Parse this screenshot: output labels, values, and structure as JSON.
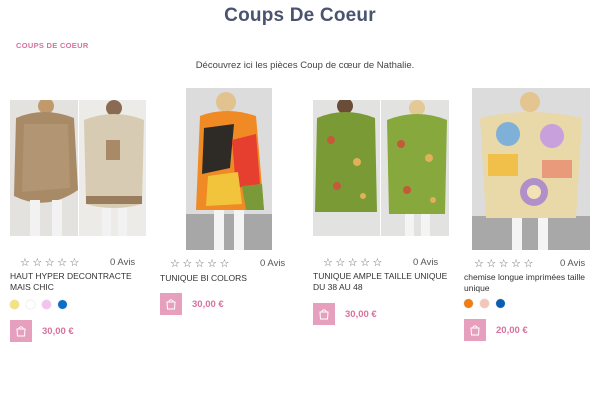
{
  "header": {
    "title": "Coups De Coeur"
  },
  "breadcrumb": {
    "label": "COUPS DE COEUR"
  },
  "intro": {
    "text": "Découvrez ici les pièces Coup de cœur de Nathalie."
  },
  "products": [
    {
      "name": "HAUT HYPER DECONTRACTE MAIS CHIC",
      "rating_stars": 0,
      "avis": "0 Avis",
      "price": "30,00 €",
      "swatches": [
        "#f7e27a",
        "#ffffff",
        "#f4c2f0",
        "#0b6fc9"
      ]
    },
    {
      "name": "TUNIQUE BI COLORS",
      "rating_stars": 0,
      "avis": "0 Avis",
      "price": "30,00 €",
      "swatches": []
    },
    {
      "name": "TUNIQUE AMPLE TAILLE UNIQUE DU 38 AU 48",
      "rating_stars": 0,
      "avis": "0 Avis",
      "price": "30,00 €",
      "swatches": []
    },
    {
      "name": "chemise longue imprimées taille unique",
      "rating_stars": 0,
      "avis": "0 Avis",
      "price": "20,00 €",
      "swatches": [
        "#f07d10",
        "#f4c6b6",
        "#0b5fb3"
      ]
    }
  ],
  "colors": {
    "title": "#4a5470",
    "accent": "#d7729e",
    "cart_button": "#e6a0bd"
  },
  "icons": {
    "star": "star-outline-icon",
    "cart": "shopping-bag-icon"
  }
}
